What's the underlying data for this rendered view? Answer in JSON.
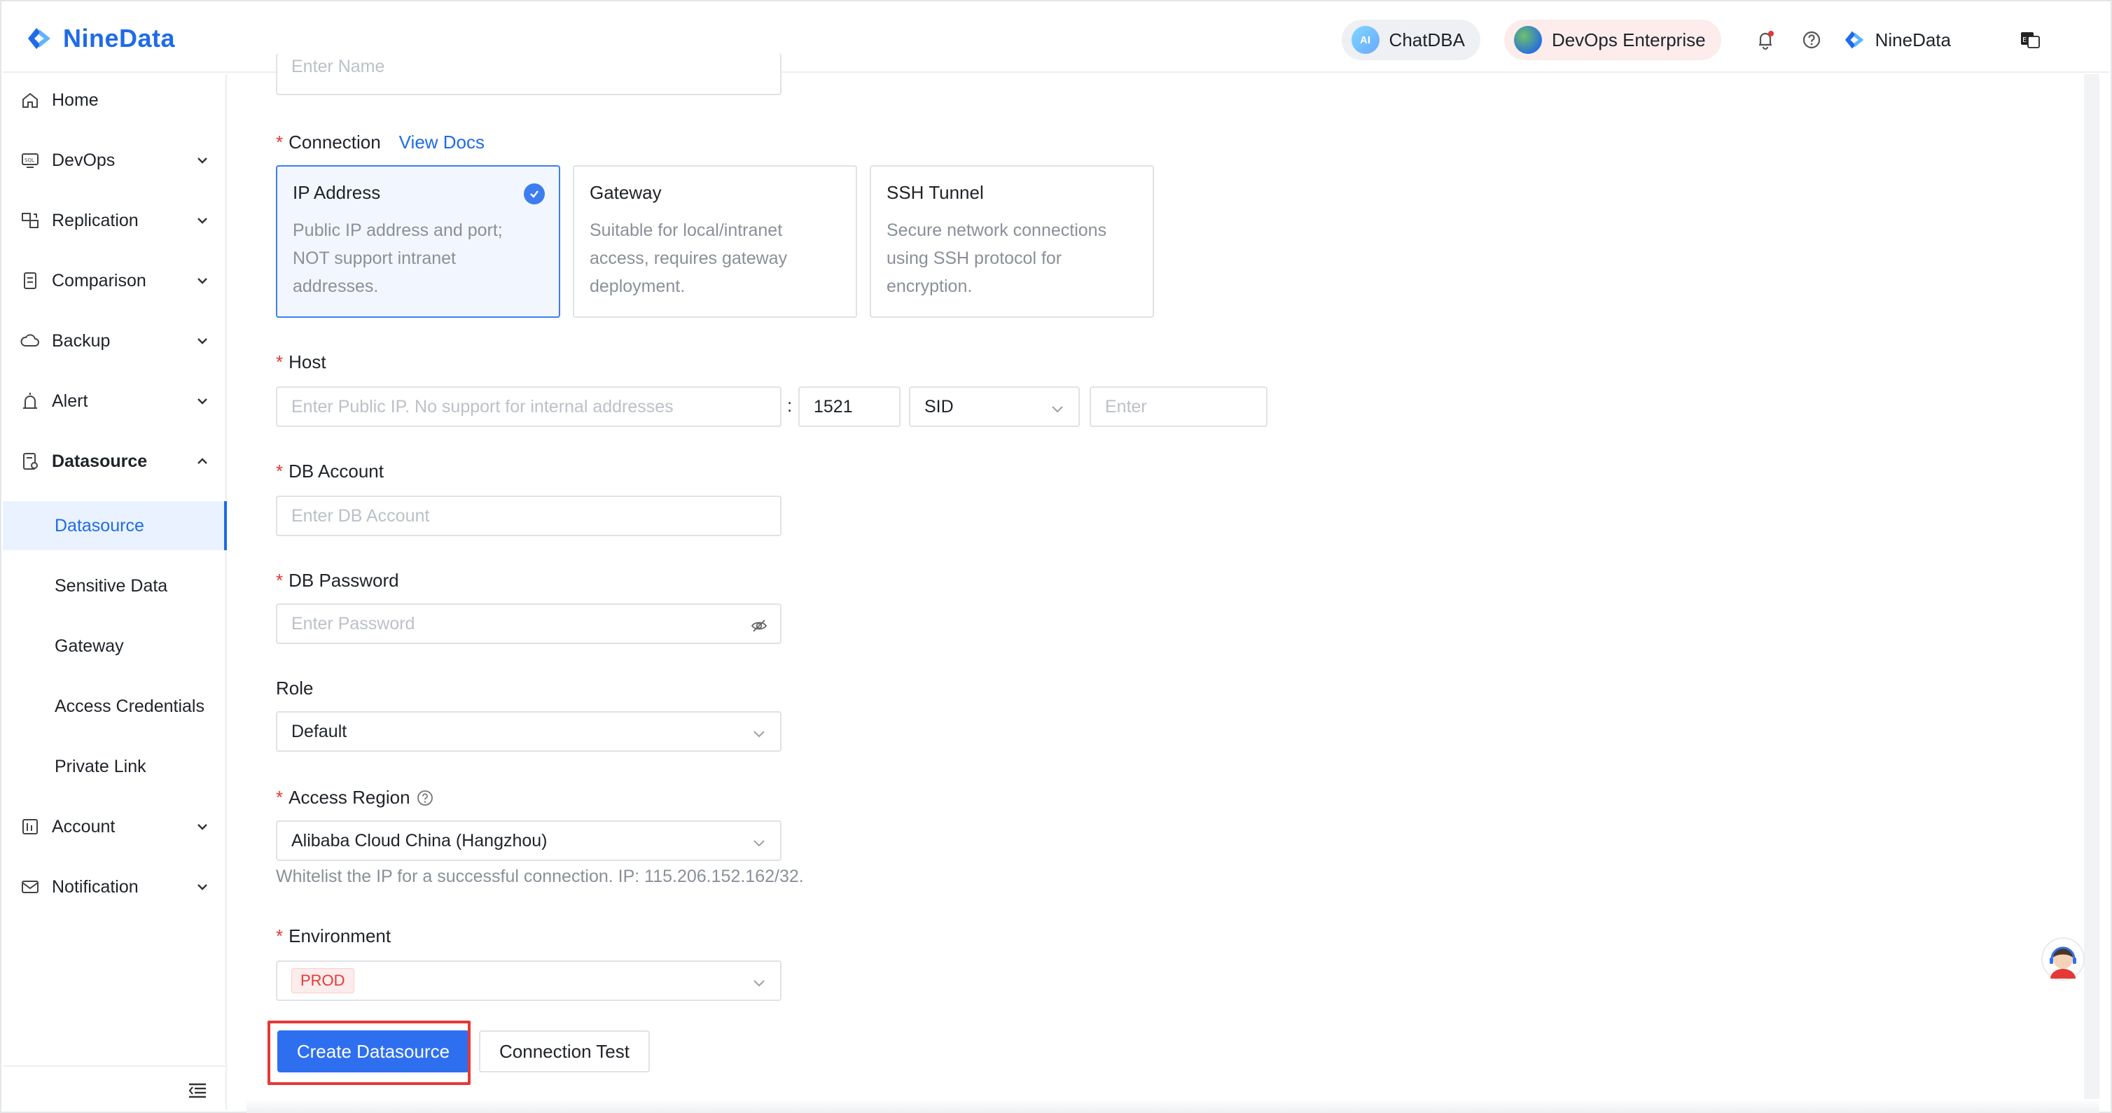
{
  "header": {
    "brand": "NineData",
    "chatdba_label": "ChatDBA",
    "chatdba_badge": "AI",
    "devops_label": "DevOps Enterprise",
    "user_name": "NineData"
  },
  "sidebar": {
    "items": [
      {
        "label": "Home",
        "icon": "home-icon"
      },
      {
        "label": "DevOps",
        "icon": "sql-monitor-icon"
      },
      {
        "label": "Replication",
        "icon": "replication-icon"
      },
      {
        "label": "Comparison",
        "icon": "comparison-icon"
      },
      {
        "label": "Backup",
        "icon": "cloud-backup-icon"
      },
      {
        "label": "Alert",
        "icon": "alarm-icon"
      },
      {
        "label": "Datasource",
        "icon": "datasource-icon"
      },
      {
        "label": "Account",
        "icon": "account-icon"
      },
      {
        "label": "Notification",
        "icon": "mail-icon"
      }
    ],
    "sub_items": [
      {
        "label": "Datasource",
        "active": true
      },
      {
        "label": "Sensitive Data",
        "active": false
      },
      {
        "label": "Gateway",
        "active": false
      },
      {
        "label": "Access Credentials",
        "active": false
      },
      {
        "label": "Private Link",
        "active": false
      }
    ]
  },
  "form": {
    "name_placeholder": "Enter Name",
    "connection_label": "Connection",
    "view_docs": "View Docs",
    "connection_options": [
      {
        "title": "IP Address",
        "desc": "Public IP address and port; NOT support intranet addresses.",
        "selected": true
      },
      {
        "title": "Gateway",
        "desc": "Suitable for local/intranet access, requires gateway deployment.",
        "selected": false
      },
      {
        "title": "SSH Tunnel",
        "desc": "Secure network connections using SSH protocol for encryption.",
        "selected": false
      }
    ],
    "host_label": "Host",
    "host_placeholder": "Enter Public IP. No support for internal addresses",
    "host_separator": ":",
    "port_value": "1521",
    "sid_value": "SID",
    "sid_placeholder": "Enter",
    "db_account_label": "DB Account",
    "db_account_placeholder": "Enter DB Account",
    "db_password_label": "DB Password",
    "db_password_placeholder": "Enter Password",
    "role_label": "Role",
    "role_value": "Default",
    "access_region_label": "Access Region",
    "access_region_value": "Alibaba Cloud China (Hangzhou)",
    "whitelist_hint": "Whitelist the IP for a successful connection. IP: 115.206.152.162/32.",
    "environment_label": "Environment",
    "environment_value": "PROD",
    "required_mark": "*"
  },
  "actions": {
    "create_label": "Create Datasource",
    "test_label": "Connection Test"
  },
  "colors": {
    "brand_blue": "#1f6be8",
    "primary_button": "#2e6ff0",
    "required_red": "#e53935",
    "highlight_red": "#e53935"
  }
}
